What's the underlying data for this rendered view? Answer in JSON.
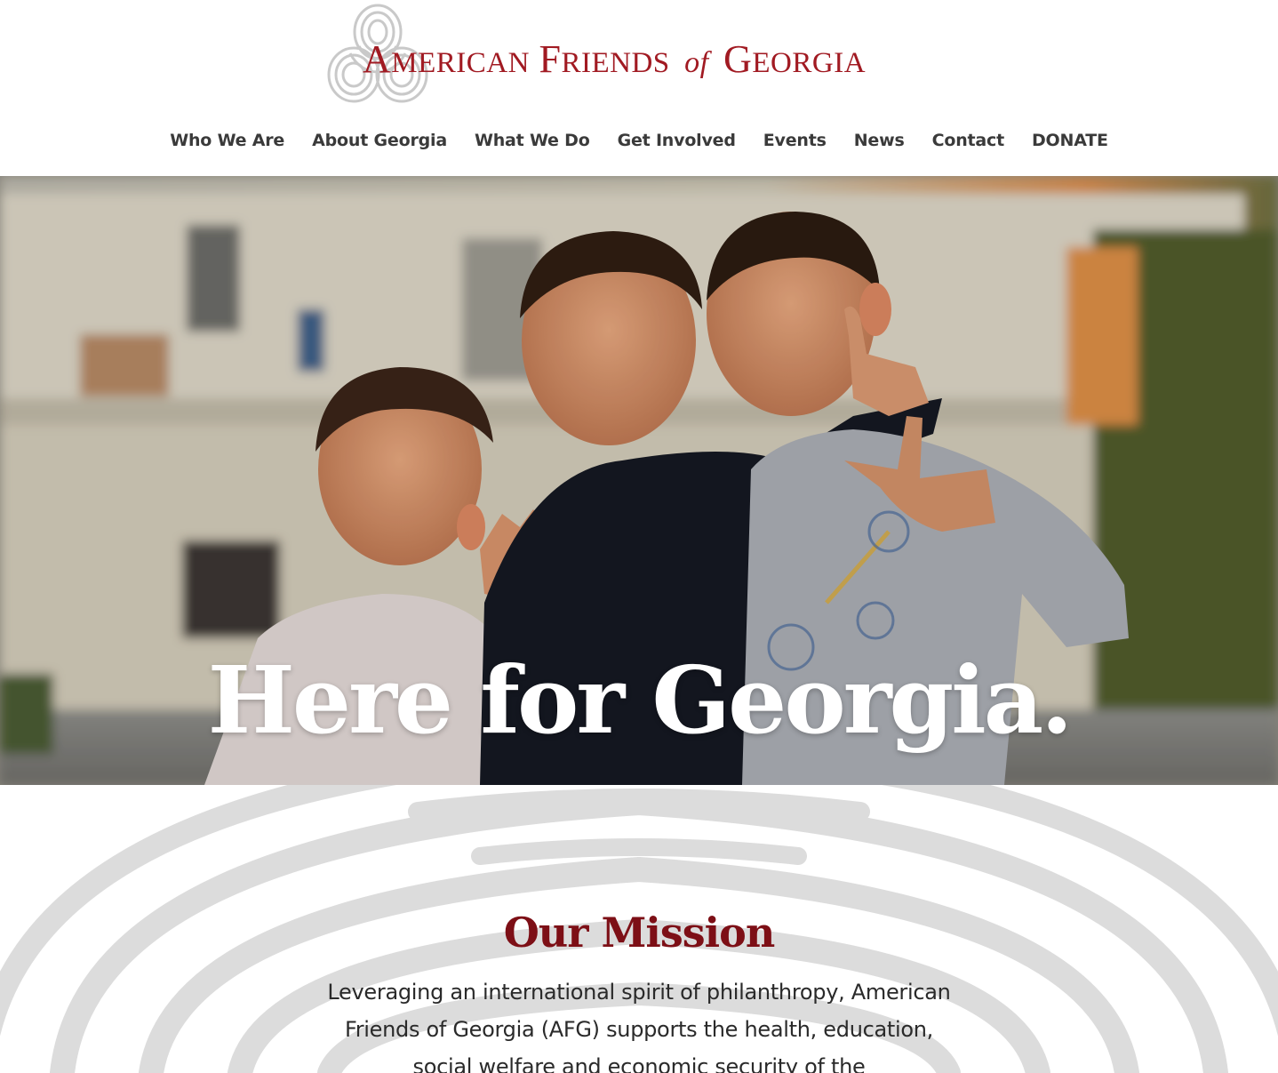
{
  "brand": {
    "cap_a": "A",
    "word_merican": "MERICAN",
    "cap_f": "F",
    "word_riends": "RIENDS",
    "of": "of",
    "cap_g": "G",
    "word_eorgia": "EORGIA",
    "logo_icon": "georgian-knot-icon",
    "color": "#a11a22"
  },
  "nav": {
    "items": [
      {
        "label": "Who We Are"
      },
      {
        "label": "About Georgia"
      },
      {
        "label": "What We Do"
      },
      {
        "label": "Get Involved"
      },
      {
        "label": "Events"
      },
      {
        "label": "News"
      },
      {
        "label": "Contact"
      },
      {
        "label": "DONATE"
      }
    ]
  },
  "hero": {
    "title": "Here for Georgia."
  },
  "mission": {
    "title": "Our Mission",
    "text": "Leveraging an international spirit of philanthropy, American Friends of Georgia (AFG) supports the health, education, social welfare and economic security of the",
    "title_color": "#7d0f16"
  }
}
